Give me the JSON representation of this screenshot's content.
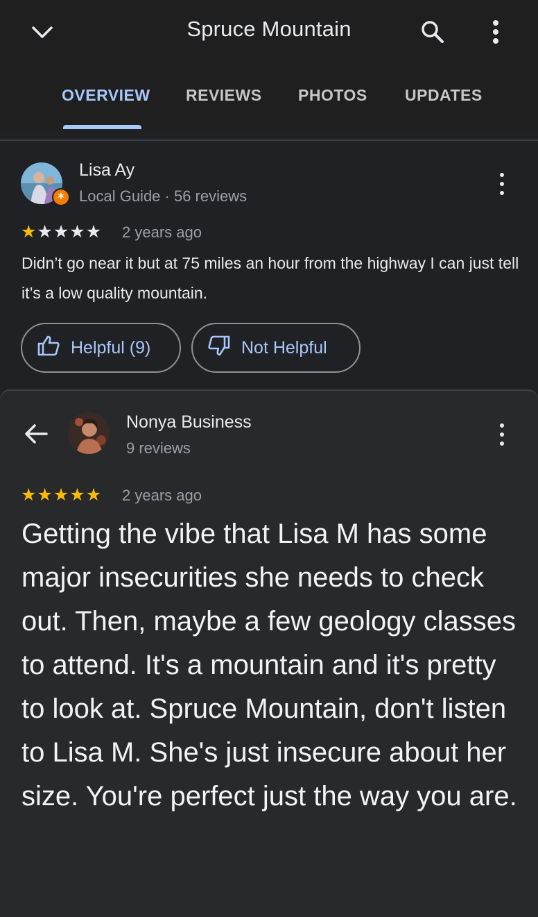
{
  "header": {
    "title": "Spruce Mountain",
    "icons": {
      "collapse": "chevron-down-icon",
      "search": "search-icon",
      "more": "more-vert-icon"
    }
  },
  "tabs": [
    {
      "label": "OVERVIEW",
      "active": true
    },
    {
      "label": "REVIEWS",
      "active": false
    },
    {
      "label": "PHOTOS",
      "active": false
    },
    {
      "label": "UPDATES",
      "active": false
    }
  ],
  "colors": {
    "accent": "#a8c7fa",
    "star": "#fbbc04",
    "background": "#202124",
    "badge": "#f57c00"
  },
  "review1": {
    "author": "Lisa Ay",
    "meta": "Local Guide · 56 reviews",
    "rating": 1,
    "max_rating": 5,
    "time": "2 years ago",
    "text": "Didn’t go near it but at 75 miles an hour from the highway I can just tell it’s a low quality mountain.",
    "helpful_label": "Helpful (9)",
    "not_helpful_label": "Not Helpful"
  },
  "review2": {
    "author": "Nonya Business",
    "meta": "9 reviews",
    "rating": 5,
    "max_rating": 5,
    "time": "2 years ago",
    "text": "Getting the vibe that Lisa M has some major insecurities she needs to check out. Then, maybe a few geology classes to attend. It's a mountain and it's pretty to look at. Spruce Mountain, don't listen to Lisa M. She's just insecure about her size. You're perfect just the way you are."
  }
}
